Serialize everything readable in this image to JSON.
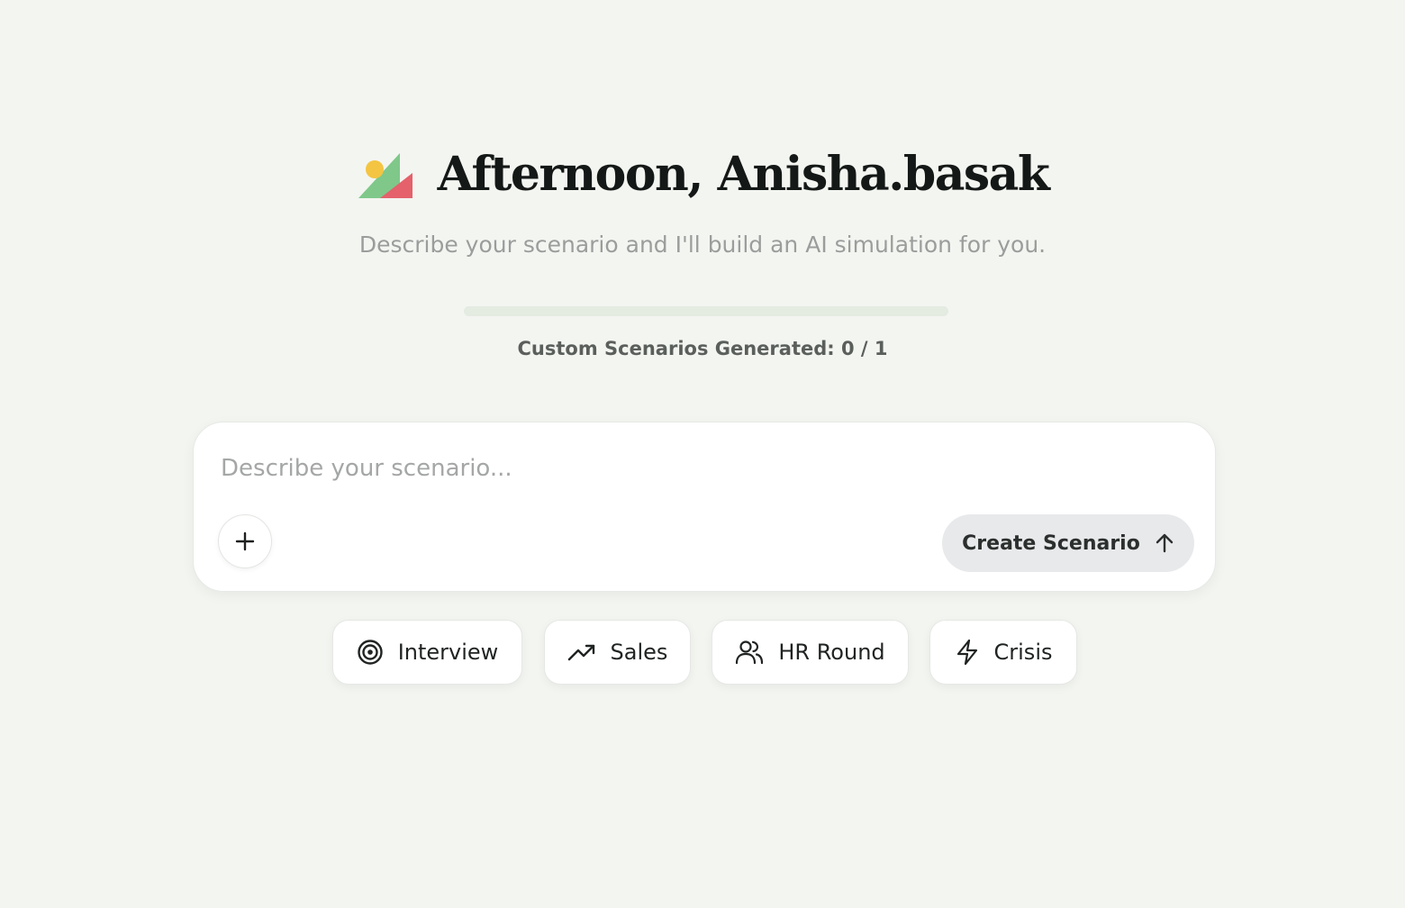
{
  "header": {
    "greeting": "Afternoon, Anisha.basak",
    "subtitle": "Describe your scenario and I'll build an AI simulation for you."
  },
  "usage": {
    "label": "Custom Scenarios Generated: 0 / 1",
    "progress_fraction": 0
  },
  "composer": {
    "placeholder": "Describe your scenario...",
    "value": "",
    "add_icon": "plus-icon",
    "create_label": "Create Scenario",
    "create_icon": "arrow-up-icon"
  },
  "suggestions": [
    {
      "label": "Interview",
      "icon": "target-icon"
    },
    {
      "label": "Sales",
      "icon": "trending-up-icon"
    },
    {
      "label": "HR Round",
      "icon": "users-icon"
    },
    {
      "label": "Crisis",
      "icon": "lightning-icon"
    }
  ],
  "colors": {
    "background": "#f3f5f1",
    "progress_track": "#e4ebe1",
    "create_button_bg": "#e8e9eb",
    "logo_green": "#7fc88a",
    "logo_red": "#e5616b",
    "logo_yellow": "#f4c542"
  }
}
